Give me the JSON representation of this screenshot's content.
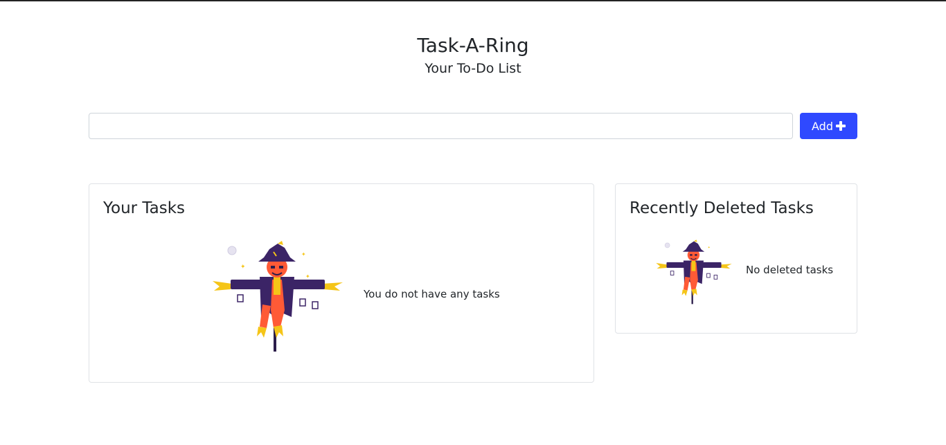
{
  "header": {
    "title": "Task-A-Ring",
    "subtitle": "Your To-Do List"
  },
  "task_form": {
    "input_value": "",
    "input_placeholder": "",
    "add_label": "Add"
  },
  "tasks_panel": {
    "title": "Your Tasks",
    "empty_message": "You do not have any tasks"
  },
  "deleted_panel": {
    "title": "Recently Deleted Tasks",
    "empty_message": "No deleted tasks"
  },
  "colors": {
    "accent": "#2f49ff",
    "border": "#dfe2e6",
    "scarecrow_purple": "#3b2466",
    "scarecrow_orange": "#ff5a36",
    "scarecrow_yellow": "#f5c518"
  },
  "icons": {
    "add_button_icon": "plus-icon",
    "empty_illustration": "scarecrow-illustration"
  }
}
